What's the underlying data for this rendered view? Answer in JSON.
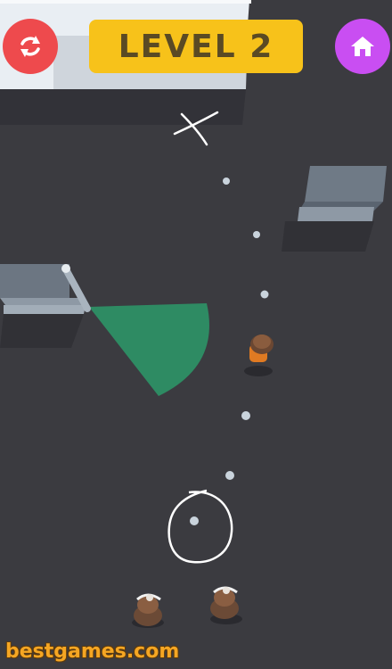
{
  "hud": {
    "level_label": "LEVEL 2",
    "restart_icon": "refresh-icon",
    "home_icon": "home-icon",
    "restart_color": "#ee4a4d",
    "home_color": "#c94ef2",
    "badge_color": "#f7c21a"
  },
  "watermark": "bestgames.com",
  "scene": {
    "floor_color": "#3b3b40",
    "vision_cone_color": "#2e8b63",
    "path_dots": 7,
    "characters": [
      "prisoner",
      "guard",
      "guard"
    ]
  }
}
